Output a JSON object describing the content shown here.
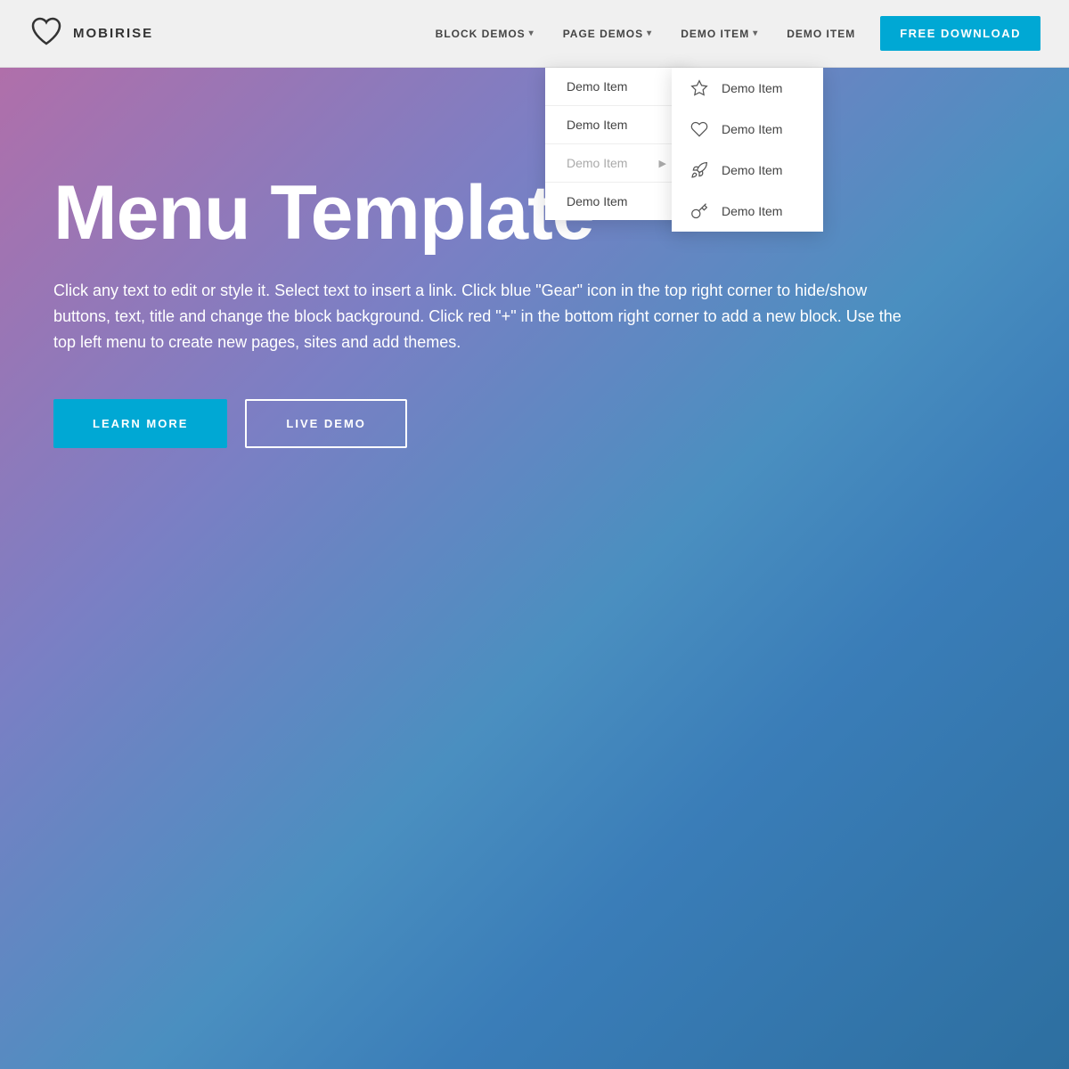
{
  "navbar": {
    "brand": {
      "name": "MOBIRISE"
    },
    "nav_items": [
      {
        "label": "BLOCK DEMOS",
        "has_dropdown": true
      },
      {
        "label": "PAGE DEMOS",
        "has_dropdown": true
      },
      {
        "label": "DEMO ITEM",
        "has_dropdown": true
      },
      {
        "label": "DEMO ITEM",
        "has_dropdown": false
      }
    ],
    "free_download_label": "FREE DOWNLOAD"
  },
  "dropdown": {
    "items": [
      {
        "label": "Demo Item",
        "has_submenu": false
      },
      {
        "label": "Demo Item",
        "has_submenu": false
      },
      {
        "label": "Demo Item",
        "has_submenu": true
      },
      {
        "label": "Demo Item",
        "has_submenu": false
      }
    ]
  },
  "submenu": {
    "items": [
      {
        "label": "Demo Item",
        "icon": "star"
      },
      {
        "label": "Demo Item",
        "icon": "heart"
      },
      {
        "label": "Demo Item",
        "icon": "rocket"
      },
      {
        "label": "Demo Item",
        "icon": "key"
      }
    ]
  },
  "hero": {
    "title": "Menu Template",
    "description": "Click any text to edit or style it. Select text to insert a link. Click blue \"Gear\" icon in the top right corner to hide/show buttons, text, title and change the block background. Click red \"+\" in the bottom right corner to add a new block. Use the top left menu to create new pages, sites and add themes.",
    "btn_learn_more": "LEARN MORE",
    "btn_live_demo": "LIVE DEMO"
  },
  "colors": {
    "accent_blue": "#00a8d4"
  }
}
